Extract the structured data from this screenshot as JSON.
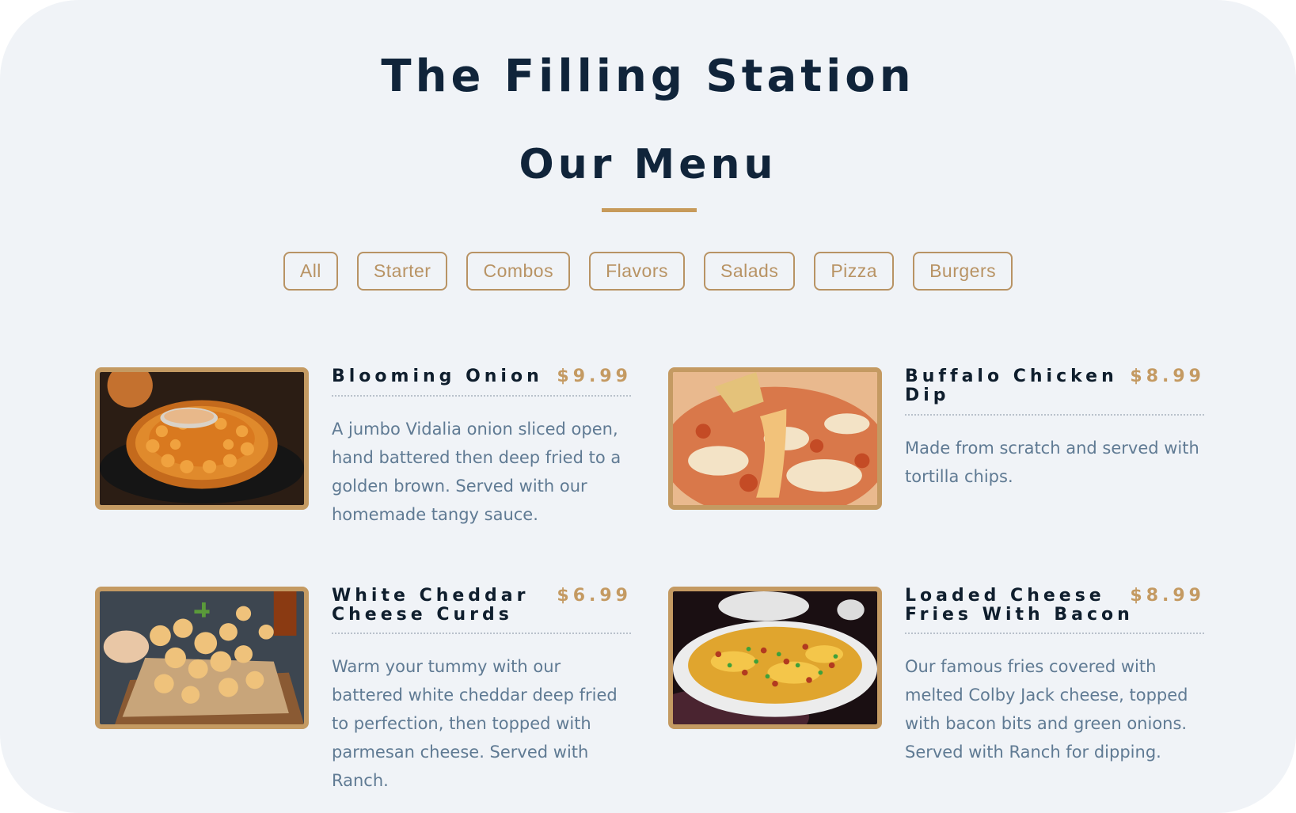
{
  "header": {
    "restaurant_name": "The Filling Station",
    "menu_title": "Our Menu"
  },
  "filters": [
    "All",
    "Starter",
    "Combos",
    "Flavors",
    "Salads",
    "Pizza",
    "Burgers"
  ],
  "items": [
    {
      "name": "Blooming Onion",
      "price": "$9.99",
      "description": "A jumbo Vidalia onion sliced open, hand battered then deep fried to a golden brown. Served with our homemade tangy sauce.",
      "photo": "blooming-onion-photo"
    },
    {
      "name": "Buffalo Chicken Dip",
      "price": "$8.99",
      "description": "Made from scratch and served with tortilla chips.",
      "photo": "buffalo-chicken-dip-photo"
    },
    {
      "name": "White Cheddar Cheese Curds",
      "price": "$6.99",
      "description": "Warm your tummy with our battered white cheddar deep fried to perfection, then topped with parmesan cheese. Served with Ranch.",
      "photo": "cheese-curds-photo"
    },
    {
      "name": "Loaded Cheese Fries With Bacon",
      "price": "$8.99",
      "description": "Our famous fries covered with melted Colby Jack cheese, topped with bacon bits and green onions. Served with Ranch for dipping.",
      "photo": "loaded-fries-photo"
    }
  ],
  "colors": {
    "background": "#f0f3f7",
    "heading": "#10243a",
    "accent": "#c49a62",
    "description": "#5f7a93"
  }
}
